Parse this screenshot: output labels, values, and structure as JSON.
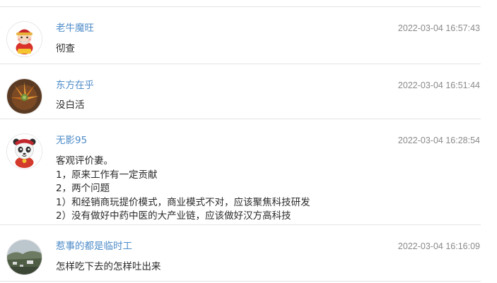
{
  "comments": [
    {
      "username": "老牛魔旺",
      "timestamp": "2022-03-04 16:57:43",
      "lines": [
        "彻查"
      ],
      "avatar_icon": "cartoon-caishen-icon"
    },
    {
      "username": "东方在乎",
      "timestamp": "2022-03-04 16:51:44",
      "lines": [
        "没白活"
      ],
      "avatar_icon": "succulent-plant-photo"
    },
    {
      "username": "无影95",
      "timestamp": "2022-03-04 16:28:54",
      "lines": [
        "客观评价妻。",
        "1，原来工作有一定贡献",
        "2，两个问题",
        "1）和经销商玩提价模式，商业模式不对，应该聚焦科技研发",
        "2）没有做好中药中医的大产业链，应该做好汉方高科技"
      ],
      "avatar_icon": "cartoon-panda-icon"
    },
    {
      "username": "惹事的都是临时工",
      "timestamp": "2022-03-04 16:16:09",
      "lines": [
        "怎样吃下去的怎样吐出来"
      ],
      "avatar_icon": "landscape-photo"
    }
  ],
  "colors": {
    "username": "#4e8cc9",
    "timestamp": "#8a8a8a",
    "body": "#2b2b2b",
    "divider": "#e4e4e4"
  }
}
